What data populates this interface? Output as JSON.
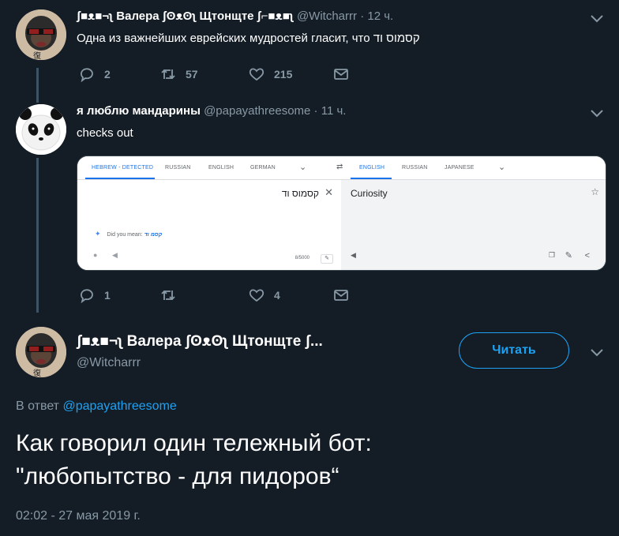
{
  "tweets": [
    {
      "name": "ʃ■ᴥ■¬ʅ Валера ʃʘᴥʘʅ Щтонщте ʃ⌐■ᴥ■ʅ",
      "handle": "@Witcharrr",
      "dot": "·",
      "time": "12 ч.",
      "text": "Одна из важнейших еврейских мудростей гласит, что קסמוס וד",
      "replies": "2",
      "retweets": "57",
      "likes": "215"
    },
    {
      "name": "я люблю мандарины",
      "handle": "@papayathreesome",
      "dot": "·",
      "time": "11 ч.",
      "text": "checks out",
      "replies": "1",
      "retweets": "",
      "likes": "4"
    }
  ],
  "translate_card": {
    "source_tabs": [
      "HEBREW - DETECTED",
      "RUSSIAN",
      "ENGLISH",
      "GERMAN"
    ],
    "target_tabs": [
      "ENGLISH",
      "RUSSIAN",
      "JAPANESE"
    ],
    "swap_icon": "⇄",
    "dropdown_icon": "⌄",
    "source_text": "קסמוס וד",
    "clear_icon": "✕",
    "did_you_mean_label": "Did you mean:",
    "did_you_mean_value": "קסמ וד",
    "char_count": "8/5000",
    "output_text": "Curiosity",
    "star_icon": "☆"
  },
  "main_tweet": {
    "name": "ʃ■ᴥ■¬ʅ Валера ʃʘᴥʘʅ Щтонщте ʃ...",
    "handle": "@Witcharrr",
    "follow_label": "Читать",
    "reply_prefix": "В ответ",
    "reply_mention": "@papayathreesome",
    "text_line1": "Как говорил один тележный бот:",
    "text_line2": "\"любопытство - для пидоров“",
    "timestamp": "02:02 - 27 мая 2019 г."
  },
  "colors": {
    "background": "#141d26",
    "muted": "#8899a6",
    "accent": "#1da1f2",
    "thread_line": "#3d5466"
  },
  "icons": [
    "reply-icon",
    "retweet-icon",
    "like-icon",
    "dm-icon",
    "chevron-down-icon",
    "sparkle-icon",
    "mic-icon",
    "speaker-icon",
    "copy-icon",
    "pencil-icon",
    "share-icon",
    "star-icon"
  ]
}
